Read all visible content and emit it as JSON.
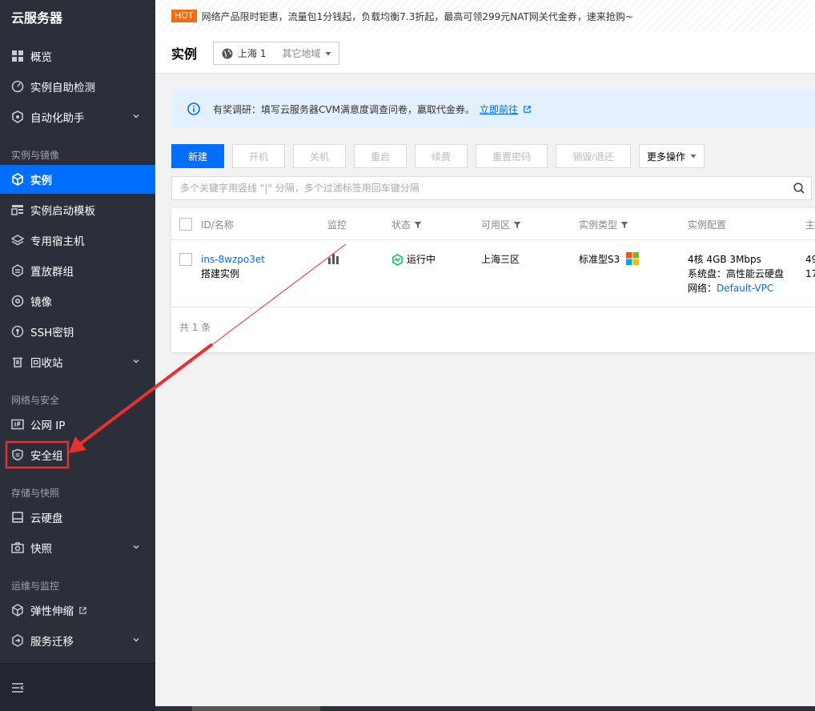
{
  "sidebar": {
    "brand": "云服务器",
    "items": [
      {
        "label": "概览"
      },
      {
        "label": "实例自助检测"
      },
      {
        "label": "自动化助手"
      },
      {
        "label": "实例"
      },
      {
        "label": "实例启动模板"
      },
      {
        "label": "专用宿主机"
      },
      {
        "label": "置放群组"
      },
      {
        "label": "镜像"
      },
      {
        "label": "SSH密钥"
      },
      {
        "label": "回收站"
      },
      {
        "label": "公网 IP"
      },
      {
        "label": "安全组"
      },
      {
        "label": "云硬盘"
      },
      {
        "label": "快照"
      },
      {
        "label": "弹性伸缩"
      },
      {
        "label": "服务迁移"
      }
    ],
    "groups": [
      "实例与镜像",
      "网络与安全",
      "存储与快照",
      "运维与监控"
    ]
  },
  "banner": {
    "badge": "HOT",
    "text": "网络产品限时钜惠，流量包1分钱起，负载均衡7.3折起，最高可领299元NAT网关代金券，速来抢购~"
  },
  "header": {
    "title": "实例",
    "region": "上海 1",
    "other_region": "其它地域"
  },
  "notice": {
    "text": "有奖调研：填写云服务器CVM满意度调查问卷，赢取代金券。",
    "link": "立即前往"
  },
  "toolbar": {
    "new": "新建",
    "start": "开机",
    "stop": "关机",
    "restart": "重启",
    "renew": "续费",
    "reset_password": "重置密码",
    "terminate": "销毁/退还",
    "more": "更多操作"
  },
  "search": {
    "placeholder": "多个关键字用竖线 \"|\" 分隔，多个过滤标签用回车键分隔"
  },
  "table": {
    "headers": {
      "id_name": "ID/名称",
      "monitor": "监控",
      "status": "状态",
      "zone": "可用区",
      "type": "实例类型",
      "config": "实例配置",
      "extra": "主"
    },
    "row": {
      "id": "ins-8wzpo3et",
      "name": "搭建实例",
      "status": "运行中",
      "zone": "上海三区",
      "type": "标准型S3",
      "config_line1": "4核 4GB 3Mbps",
      "config_line2": "系统盘：高性能云硬盘",
      "config_line3_label": "网络：",
      "config_line3_link": "Default-VPC",
      "extra_line1": "49",
      "extra_line2": "17"
    },
    "footer": "共 1 条"
  },
  "colors": {
    "sidebar_bg": "#2b2f3a",
    "active": "#006eff",
    "annotation": "#e8302e"
  }
}
